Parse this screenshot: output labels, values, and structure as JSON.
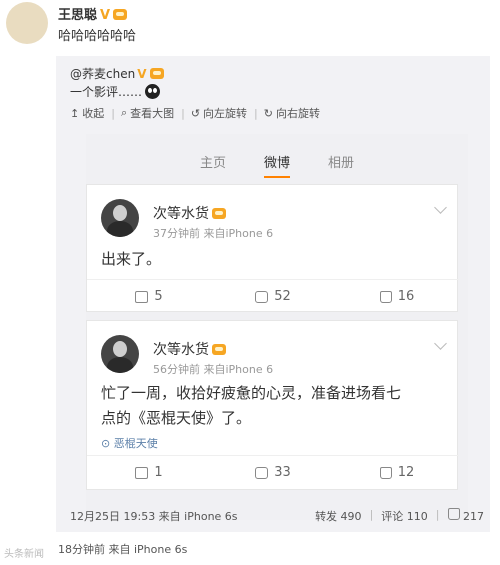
{
  "outer": {
    "author": "王思聪",
    "verified_mark": "V",
    "text": "哈哈哈哈哈哈",
    "time_source": "18分钟前 来自 iPhone 6s"
  },
  "repost": {
    "author": "@荞麦chen",
    "verified_mark": "V",
    "text": "一个影评……",
    "toolbar": [
      {
        "icon": "arrow-up-icon",
        "label": "收起"
      },
      {
        "icon": "search-icon",
        "label": "查看大图"
      },
      {
        "icon": "rotate-left-icon",
        "label": "向左旋转"
      },
      {
        "icon": "rotate-right-icon",
        "label": "向右旋转"
      }
    ],
    "footer": {
      "time_source": "12月25日 19:53 来自 iPhone 6s",
      "reposts": "转发 490",
      "comments": "评论 110",
      "likes": "217"
    }
  },
  "screenshot": {
    "tabs": [
      "主页",
      "微博",
      "相册"
    ],
    "active_tab": "微博",
    "posts": [
      {
        "author": "次等水货",
        "meta": "37分钟前  来自iPhone 6",
        "body": "出来了。",
        "topic": "",
        "shares": "5",
        "comments": "52",
        "likes": "16"
      },
      {
        "author": "次等水货",
        "meta": "56分钟前  来自iPhone 6",
        "body_line1": "忙了一周，收拾好疲惫的心灵，准备进场看七",
        "body_line2": "点的《恶棍天使》了。",
        "topic": "恶棍天使",
        "shares": "1",
        "comments": "33",
        "likes": "12"
      }
    ]
  },
  "watermark": "头条新闻"
}
